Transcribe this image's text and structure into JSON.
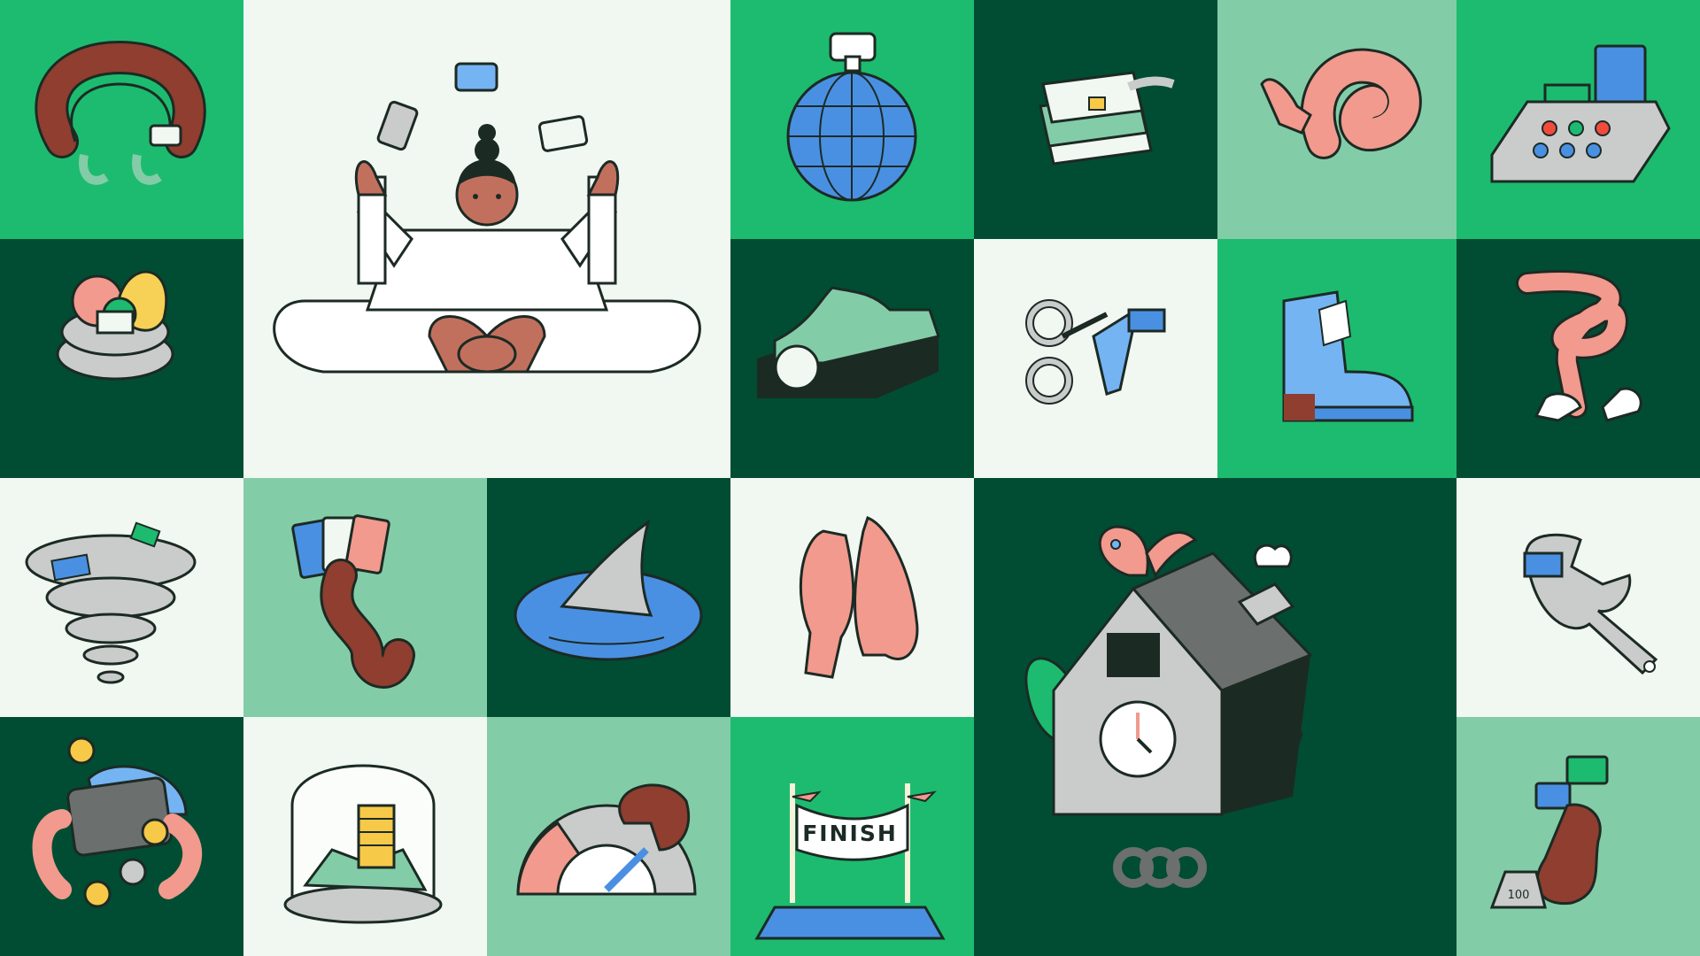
{
  "collage": {
    "palette": {
      "bright_green": "#1dbb6f",
      "dark_green": "#004d33",
      "mint": "#83cca8",
      "pale": "#f1f7f1",
      "outline": "#1c2a24",
      "skin_dark": "#8f3e2f",
      "skin_brown": "#c2705e",
      "skin_pink": "#f19a8d",
      "blue": "#4a90e2",
      "light_blue": "#75b4f2",
      "gray": "#c9cccb",
      "dark_gray": "#6b6f6d"
    },
    "tiles": [
      {
        "name": "tile-hands-bracelet",
        "background": "dark_green",
        "icon": "hands-bracelet-icon"
      },
      {
        "name": "tile-meditating-person",
        "background": "pale",
        "icon": "meditating-person-juggling-cards-icon"
      },
      {
        "name": "tile-globe-disco-ball",
        "background": "bright_green",
        "icon": "globe-icon"
      },
      {
        "name": "tile-card-sandwich",
        "background": "dark_green",
        "icon": "card-sandwich-icon"
      },
      {
        "name": "tile-pink-knot-hand",
        "background": "mint",
        "icon": "pink-knot-hand-icon"
      },
      {
        "name": "tile-card-machine",
        "background": "bright_green",
        "icon": "card-machine-icon"
      },
      {
        "name": "tile-fruit-bowl",
        "background": "dark_green",
        "icon": "fruit-bowl-icon"
      },
      {
        "name": "tile-green-mattress",
        "background": "dark_green",
        "icon": "mattress-icon"
      },
      {
        "name": "tile-scissors-receipt",
        "background": "pale",
        "icon": "scissors-receipt-icon"
      },
      {
        "name": "tile-blue-boot",
        "background": "bright_green",
        "icon": "boot-icon"
      },
      {
        "name": "tile-knot-legs",
        "background": "dark_green",
        "icon": "knot-legs-icon"
      },
      {
        "name": "tile-tornado",
        "background": "pale",
        "icon": "tornado-icon"
      },
      {
        "name": "tile-arm-cards",
        "background": "mint",
        "icon": "arm-holding-cards-icon"
      },
      {
        "name": "tile-shark-fin",
        "background": "dark_green",
        "icon": "shark-fin-icon"
      },
      {
        "name": "tile-high-five",
        "background": "pale",
        "icon": "high-five-icon"
      },
      {
        "name": "tile-cuckoo-clock",
        "background": "dark_green",
        "icon": "cuckoo-clock-house-icon"
      },
      {
        "name": "tile-wrench-card",
        "background": "pale",
        "icon": "wrench-card-icon"
      },
      {
        "name": "tile-wallet-coins",
        "background": "dark_green",
        "icon": "wallet-coins-icon"
      },
      {
        "name": "tile-money-dome",
        "background": "pale",
        "icon": "money-glass-dome-icon"
      },
      {
        "name": "tile-speedometer",
        "background": "mint",
        "icon": "speedometer-hand-icon"
      },
      {
        "name": "tile-finish-line",
        "background": "bright_green",
        "icon": "finish-line-icon"
      },
      {
        "name": "tile-strong-arm",
        "background": "mint",
        "icon": "strong-arm-weight-icon"
      }
    ],
    "texts": {
      "finish_banner": "FINISH",
      "weight_label": "100"
    }
  }
}
